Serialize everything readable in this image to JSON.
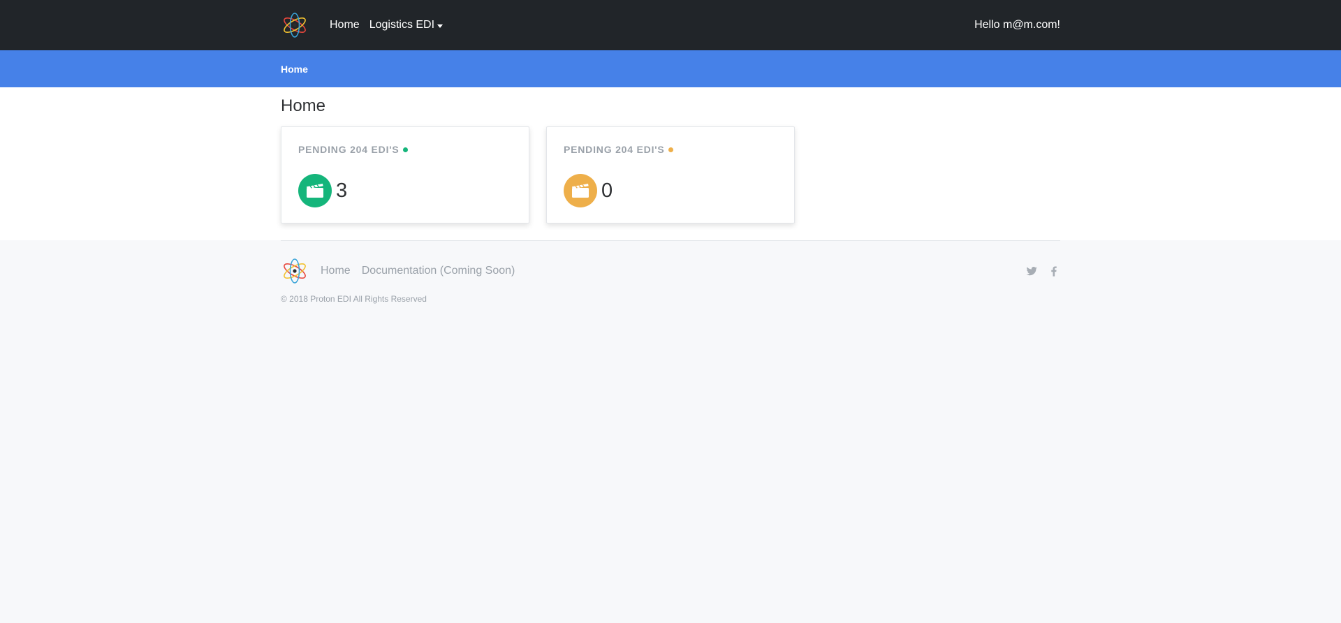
{
  "navbar": {
    "nav_items": [
      {
        "label": "Home"
      },
      {
        "label": "Logistics EDI"
      }
    ],
    "greeting": "Hello m@m.com!"
  },
  "breadcrumb": {
    "items": [
      {
        "label": "Home"
      }
    ]
  },
  "main": {
    "title": "Home",
    "cards": [
      {
        "title": "PENDING 204 EDI'S",
        "value": "3",
        "accent": "#15b57b",
        "icon": "clapperboard-icon"
      },
      {
        "title": "PENDING 204 EDI'S",
        "value": "0",
        "accent": "#eeaf4a",
        "icon": "clapperboard-icon"
      }
    ]
  },
  "footer": {
    "links": [
      {
        "label": "Home"
      },
      {
        "label": "Documentation (Coming Soon)"
      }
    ],
    "social": [
      "twitter-icon",
      "facebook-icon"
    ],
    "copyright": "© 2018 Proton EDI All Rights Reserved"
  },
  "colors": {
    "navbar_bg": "#212529",
    "breadcrumb_bg": "#4681e8",
    "page_bg": "#f7f8fa",
    "muted_text": "#9aa1a9"
  }
}
